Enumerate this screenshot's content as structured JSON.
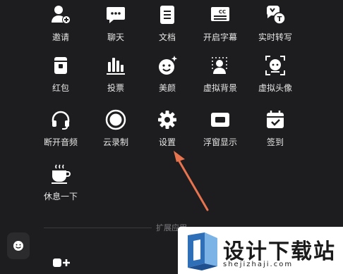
{
  "menu": {
    "items": [
      {
        "label": "邀请",
        "icon": "invite-user-icon"
      },
      {
        "label": "聊天",
        "icon": "chat-bubble-icon"
      },
      {
        "label": "文档",
        "icon": "document-icon"
      },
      {
        "label": "开启字幕",
        "icon": "captions-icon"
      },
      {
        "label": "实时转写",
        "icon": "transcribe-icon"
      },
      {
        "label": "红包",
        "icon": "red-envelope-icon"
      },
      {
        "label": "投票",
        "icon": "vote-chart-icon"
      },
      {
        "label": "美颜",
        "icon": "beauty-face-icon"
      },
      {
        "label": "虚拟背景",
        "icon": "virtual-background-icon"
      },
      {
        "label": "虚拟头像",
        "icon": "virtual-avatar-icon"
      },
      {
        "label": "断开音频",
        "icon": "headphones-icon"
      },
      {
        "label": "云录制",
        "icon": "cloud-record-icon"
      },
      {
        "label": "设置",
        "icon": "gear-icon"
      },
      {
        "label": "浮窗显示",
        "icon": "floating-window-icon"
      },
      {
        "label": "签到",
        "icon": "check-in-calendar-icon"
      },
      {
        "label": "休息一下",
        "icon": "coffee-cup-icon"
      }
    ]
  },
  "extensions": {
    "section_label": "扩展应用"
  },
  "watermark": {
    "title": "设计下载站",
    "url": "shejizhaji.com"
  },
  "colors": {
    "background": "#1d1d1f",
    "arrow": "#e8734f"
  }
}
